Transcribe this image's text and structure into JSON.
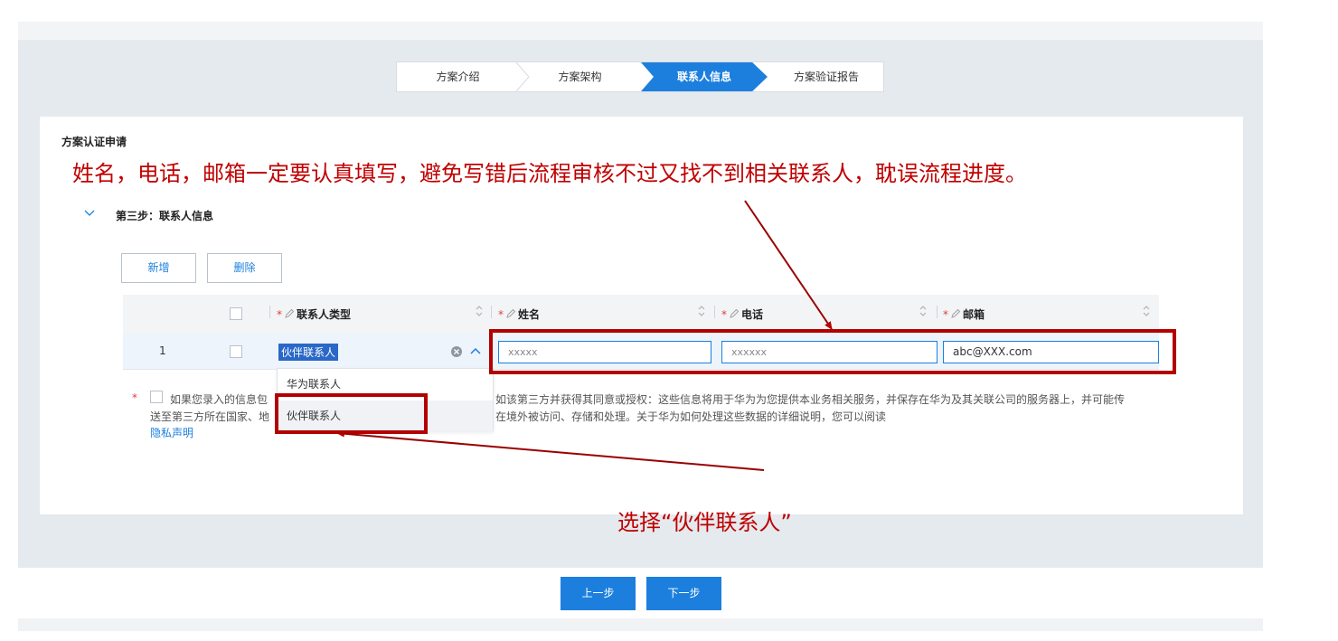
{
  "steps": [
    "方案介绍",
    "方案架构",
    "联系人信息",
    "方案验证报告"
  ],
  "active_step": "联系人信息",
  "panel_title": "方案认证申请",
  "section_title": "第三步：联系人信息",
  "buttons": {
    "add": "新增",
    "delete": "删除",
    "prev": "上一步",
    "next": "下一步"
  },
  "table": {
    "headers": {
      "type": "联系人类型",
      "name": "姓名",
      "phone": "电话",
      "email": "邮箱"
    },
    "required_mark": "*",
    "row": {
      "index": "1",
      "type": "伙伴联系人",
      "name": "xxxxx",
      "phone": "xxxxxx",
      "email": "abc@XXX.com"
    }
  },
  "dropdown_options": [
    "华为联系人",
    "伙伴联系人"
  ],
  "consent": {
    "line1_a": "如果您录入的信息包",
    "line1_b": "如该第三方并获得其同意或授权：这些信息将用于华为为您提供本业务相关服务，并保存在华为及其关联公司的服务器上，并可能传",
    "line2_a": "送至第三方所在国家、地",
    "line2_b": "在境外被访问、存储和处理。关于华为如何处理这些数据的详细说明，您可以阅读",
    "privacy_link": "隐私声明"
  },
  "annotations": {
    "top_note": "姓名，电话，邮箱一定要认真填写，避免写错后流程审核不过又找不到相关联系人，耽误流程进度。",
    "bottom_note": "选择“伙伴联系人”"
  },
  "colors": {
    "accent": "#1c7fde",
    "annotation_red": "#c00000",
    "background_gray": "#e5eaee"
  }
}
